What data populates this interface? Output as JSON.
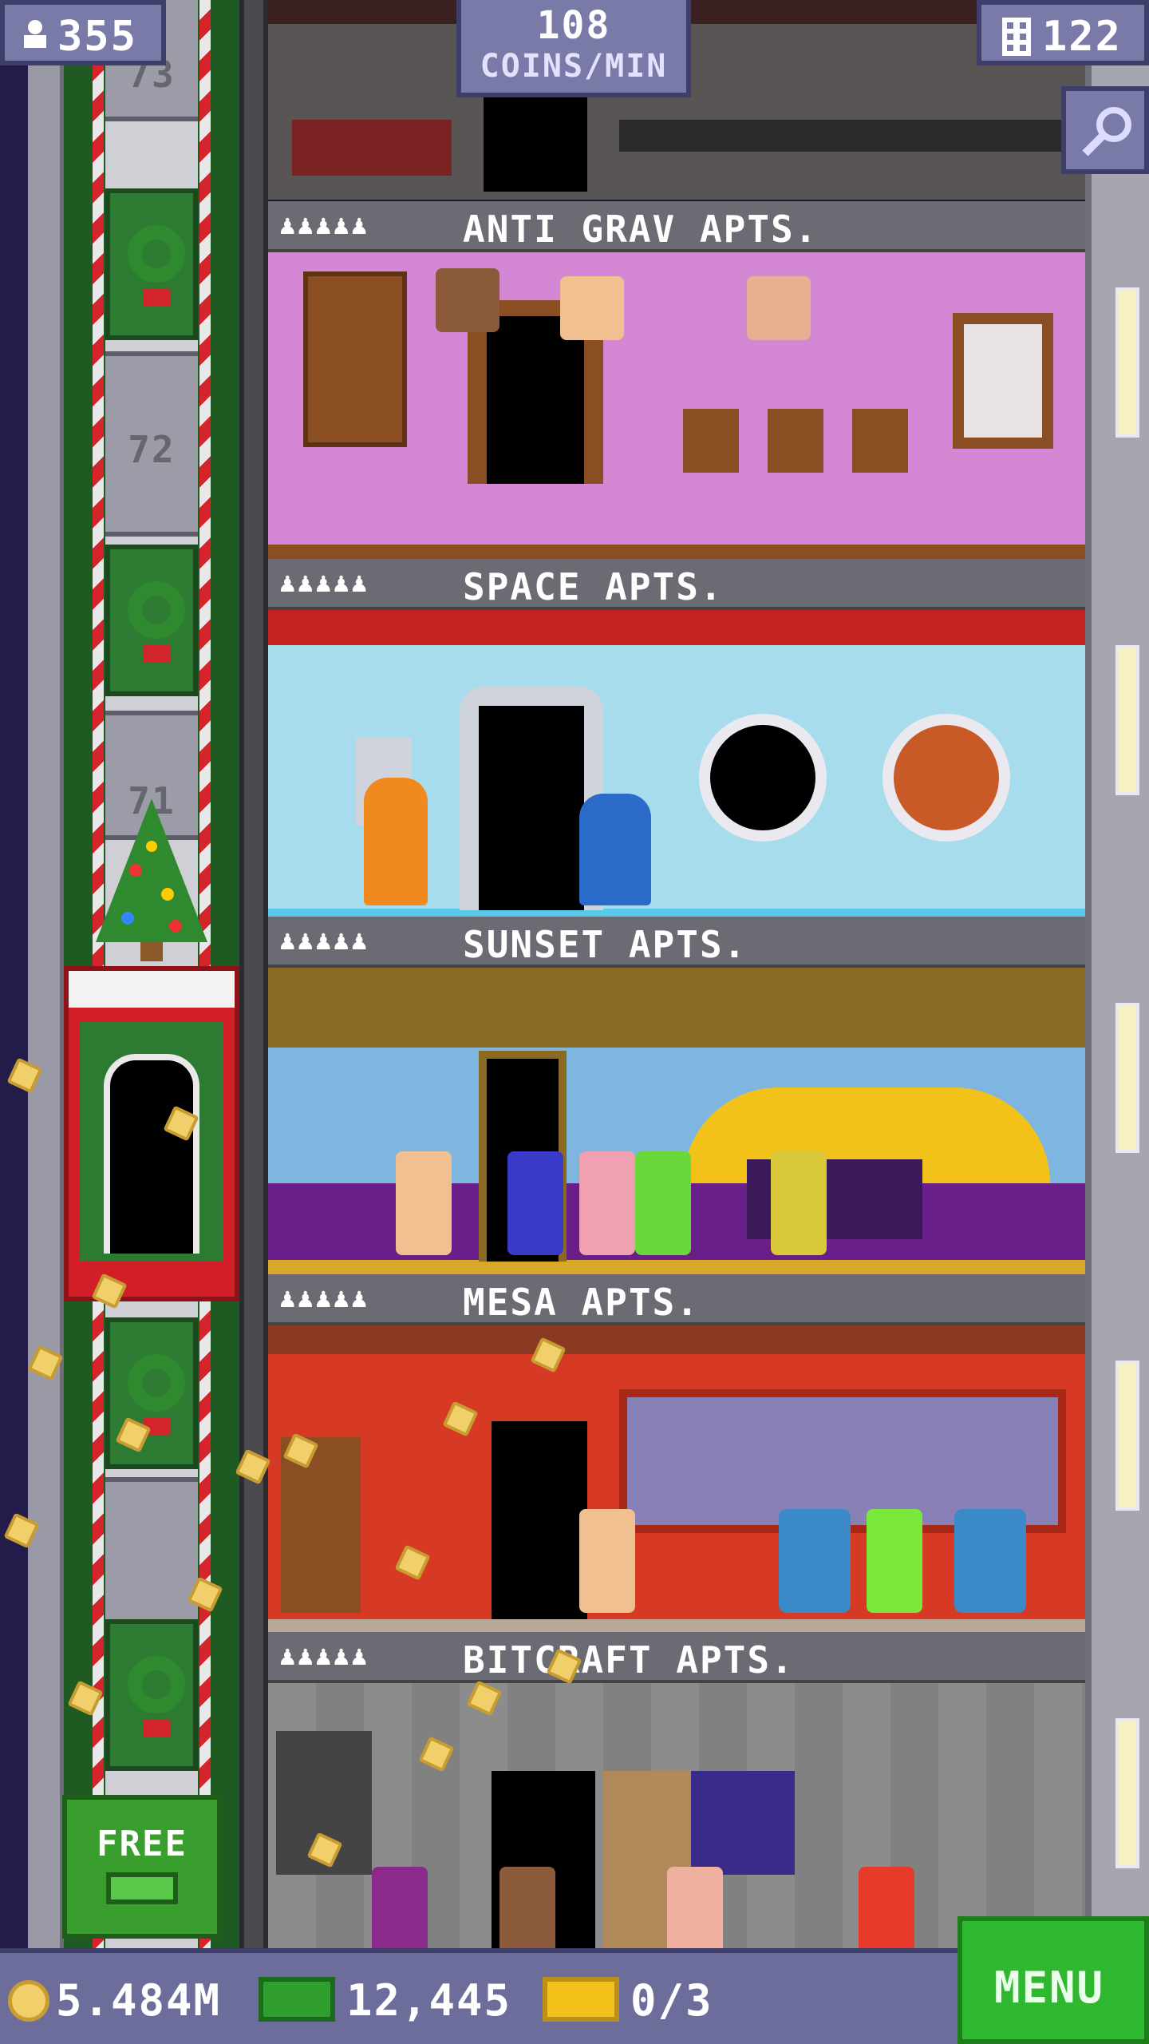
{
  "header": {
    "population": "355",
    "coins_rate_value": "108",
    "coins_rate_unit": "COINS/MIN",
    "floors_count": "122"
  },
  "elevator": {
    "floor_labels": [
      "73",
      "72",
      "71"
    ]
  },
  "floors": [
    {
      "name": "ANTI GRAV APTS.",
      "pips": "♟♟♟♟♟"
    },
    {
      "name": "SPACE APTS.",
      "pips": "♟♟♟♟♟"
    },
    {
      "name": "SUNSET APTS.",
      "pips": "♟♟♟♟♟"
    },
    {
      "name": "MESA APTS.",
      "pips": "♟♟♟♟♟"
    },
    {
      "name": "BITCRAFT APTS.",
      "pips": "♟♟♟♟♟"
    }
  ],
  "free_button": {
    "label": "FREE"
  },
  "bottom_bar": {
    "coins": "5.484M",
    "bux": "12,445",
    "tickets": "0/3",
    "menu_label": "MENU"
  },
  "colors": {
    "ui_panel": "#7a7aa8",
    "menu_green": "#2fb82f",
    "anti_grav_wall": "#d487d2",
    "space_wall": "#a6dcec",
    "sunset_sky": "#7fb6e0",
    "mesa_wall": "#d73a24",
    "bitcraft_stone": "#8c8c8c"
  },
  "icons": [
    "person-icon",
    "building-icon",
    "magnifier-icon",
    "coin-icon",
    "bux-icon",
    "ticket-icon"
  ]
}
